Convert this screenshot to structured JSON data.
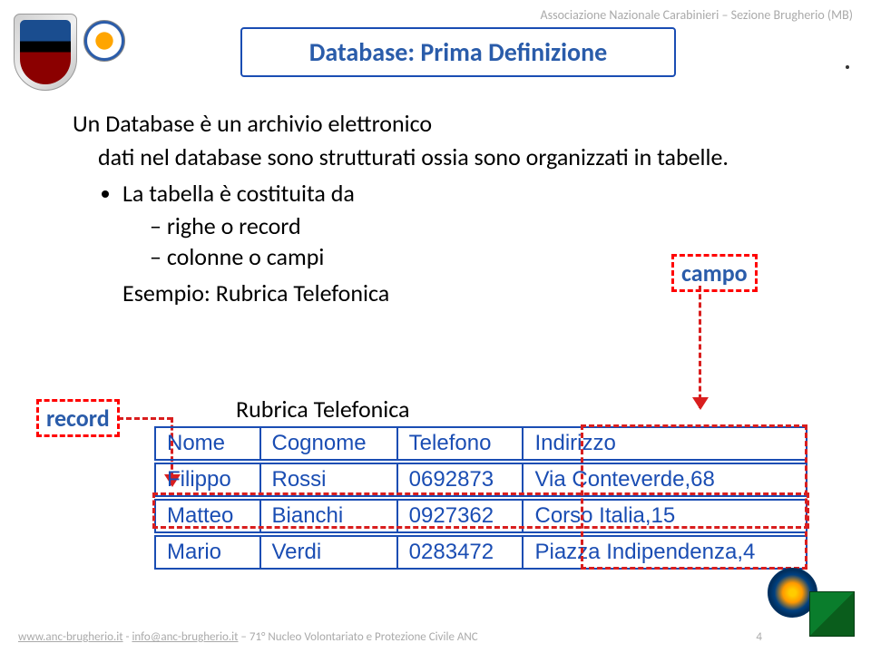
{
  "header": {
    "association": "Associazione Nazionale Carabinieri – Sezione Brugherio (MB)",
    "title": "Database: Prima Definizione"
  },
  "content": {
    "line1": "Un Database è un archivio elettronico",
    "line2": "dati nel database sono strutturati ossia sono organizzati in tabelle.",
    "bullet": "La tabella è costituita da",
    "sub1": "righe o record",
    "sub2": "colonne o campi",
    "esempio": "Esempio: Rubrica Telefonica"
  },
  "labels": {
    "campo": "campo",
    "record": "record",
    "rubrica_caption": "Rubrica Telefonica"
  },
  "table": {
    "headers": {
      "c1": "Nome",
      "c2": "Cognome",
      "c3": "Telefono",
      "c4": "Indirizzo"
    },
    "rows": [
      {
        "c1": "Filippo",
        "c2": "Rossi",
        "c3": "0692873",
        "c4": "Via Conteverde,68"
      },
      {
        "c1": "Matteo",
        "c2": "Bianchi",
        "c3": "0927362",
        "c4": "Corso Italia,15"
      },
      {
        "c1": "Mario",
        "c2": "Verdi",
        "c3": "0283472",
        "c4": "Piazza Indipendenza,4"
      }
    ]
  },
  "footer": {
    "site": "www.anc-brugherio.it",
    "sep1": " - ",
    "email": "info@anc-brugherio.it",
    "rest": " – 71° Nucleo Volontariato e Protezione Civile ANC",
    "page": "4"
  }
}
